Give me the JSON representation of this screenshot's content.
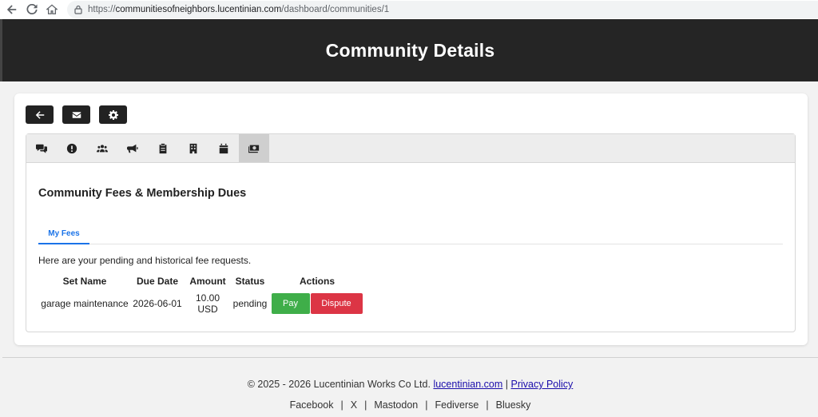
{
  "browser": {
    "url_prefix": "https://",
    "url_host": "communitiesofneighbors.lucentinian.com",
    "url_path": "/dashboard/communities/1"
  },
  "header": {
    "title": "Community Details"
  },
  "toolbar": {
    "buttons": [
      {
        "icon": "arrow-left-icon"
      },
      {
        "icon": "envelope-icon"
      },
      {
        "icon": "gear-icon"
      }
    ]
  },
  "tabs": {
    "icons": [
      "comments-icon",
      "alert-icon",
      "users-icon",
      "megaphone-icon",
      "clipboard-icon",
      "building-icon",
      "calendar-icon",
      "money-icon"
    ],
    "active_index": 7
  },
  "section": {
    "title": "Community Fees & Membership Dues",
    "subtab_label": "My Fees",
    "description": "Here are your pending and historical fee requests."
  },
  "table": {
    "headers": [
      "Set Name",
      "Due Date",
      "Amount",
      "Status",
      "Actions"
    ],
    "rows": [
      {
        "set_name": "garage maintenance",
        "due_date": "2026-06-01",
        "amount": "10.00 USD",
        "status": "pending",
        "pay_label": "Pay",
        "dispute_label": "Dispute"
      }
    ]
  },
  "footer": {
    "copyright": "© 2025 - 2026 Lucentinian Works Co Ltd.",
    "site_link": "lucentinian.com",
    "divider": "|",
    "privacy_link": "Privacy Policy",
    "social": [
      "Facebook",
      "X",
      "Mastodon",
      "Fediverse",
      "Bluesky"
    ]
  },
  "colors": {
    "header_bg": "#252525",
    "pay": "#3fae49",
    "dispute": "#dc3545",
    "accent": "#1a73e8"
  }
}
